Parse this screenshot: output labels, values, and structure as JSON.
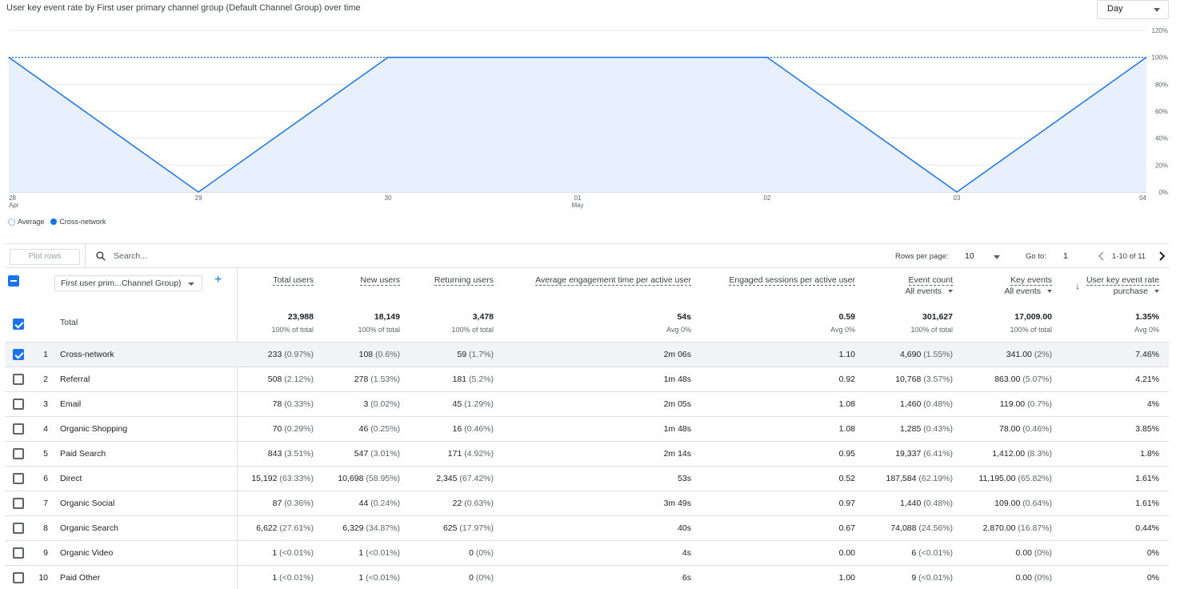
{
  "chart": {
    "title": "User key event rate by First user primary channel group (Default Channel Group) over time",
    "granularity": "Day",
    "legend": [
      {
        "label": "Average",
        "style": "dotted"
      },
      {
        "label": "Cross-network",
        "style": "solid"
      }
    ],
    "accent_color": "#1a73e8",
    "fill_color": "#e8f0fe"
  },
  "chart_data": {
    "type": "area",
    "title": "User key event rate by First user primary channel group (Default Channel Group) over time",
    "x_ticks": [
      {
        "label": "28",
        "sublabel": "Apr"
      },
      {
        "label": "29",
        "sublabel": ""
      },
      {
        "label": "30",
        "sublabel": ""
      },
      {
        "label": "01",
        "sublabel": "May"
      },
      {
        "label": "02",
        "sublabel": ""
      },
      {
        "label": "03",
        "sublabel": ""
      },
      {
        "label": "04",
        "sublabel": ""
      }
    ],
    "y_ticks": [
      "0%",
      "20%",
      "40%",
      "60%",
      "80%",
      "100%",
      "120%"
    ],
    "ylim": [
      0,
      120
    ],
    "series": [
      {
        "name": "Cross-network",
        "values": [
          100,
          0,
          100,
          100,
          100,
          0,
          100
        ]
      },
      {
        "name": "Average",
        "values": [
          100,
          100,
          100,
          100,
          100,
          100,
          100
        ]
      }
    ],
    "grid": true
  },
  "toolbar": {
    "plot_rows": "Plot rows",
    "search_placeholder": "Search...",
    "rows_per_page_label": "Rows per page:",
    "rows_per_page": "10",
    "goto_label": "Go to:",
    "goto_value": "1",
    "pager_text": "1-10 of 11"
  },
  "table": {
    "dimension": "First user prim...Channel Group)",
    "columns": [
      {
        "label": "Total users",
        "sub": ""
      },
      {
        "label": "New users",
        "sub": ""
      },
      {
        "label": "Returning users",
        "sub": ""
      },
      {
        "label": "Average engagement time per active user",
        "sub": ""
      },
      {
        "label": "Engaged sessions per active user",
        "sub": ""
      },
      {
        "label": "Event count",
        "sub": "All events"
      },
      {
        "label": "Key events",
        "sub": "All events"
      },
      {
        "label": "User key event rate",
        "sub": "purchase"
      }
    ],
    "total": {
      "label": "Total",
      "values": [
        "23,988",
        "18,149",
        "3,478",
        "54s",
        "0.59",
        "301,627",
        "17,009.00",
        "1.35%"
      ],
      "subs": [
        "100% of total",
        "100% of total",
        "100% of total",
        "Avg 0%",
        "Avg 0%",
        "100% of total",
        "100% of total",
        "Avg 0%"
      ]
    },
    "rows": [
      {
        "idx": "1",
        "name": "Cross-network",
        "checked": true,
        "cells": [
          [
            "233",
            "(0.97%)"
          ],
          [
            "108",
            "(0.6%)"
          ],
          [
            "59",
            "(1.7%)"
          ],
          [
            "2m 06s",
            ""
          ],
          [
            "1.10",
            ""
          ],
          [
            "4,690",
            "(1.55%)"
          ],
          [
            "341.00",
            "(2%)"
          ],
          [
            "7.46%",
            ""
          ]
        ]
      },
      {
        "idx": "2",
        "name": "Referral",
        "checked": false,
        "cells": [
          [
            "508",
            "(2.12%)"
          ],
          [
            "278",
            "(1.53%)"
          ],
          [
            "181",
            "(5.2%)"
          ],
          [
            "1m 48s",
            ""
          ],
          [
            "0.92",
            ""
          ],
          [
            "10,768",
            "(3.57%)"
          ],
          [
            "863.00",
            "(5.07%)"
          ],
          [
            "4.21%",
            ""
          ]
        ]
      },
      {
        "idx": "3",
        "name": "Email",
        "checked": false,
        "cells": [
          [
            "78",
            "(0.33%)"
          ],
          [
            "3",
            "(0.02%)"
          ],
          [
            "45",
            "(1.29%)"
          ],
          [
            "2m 05s",
            ""
          ],
          [
            "1.08",
            ""
          ],
          [
            "1,460",
            "(0.48%)"
          ],
          [
            "119.00",
            "(0.7%)"
          ],
          [
            "4%",
            ""
          ]
        ]
      },
      {
        "idx": "4",
        "name": "Organic Shopping",
        "checked": false,
        "cells": [
          [
            "70",
            "(0.29%)"
          ],
          [
            "46",
            "(0.25%)"
          ],
          [
            "16",
            "(0.46%)"
          ],
          [
            "1m 48s",
            ""
          ],
          [
            "1.08",
            ""
          ],
          [
            "1,285",
            "(0.43%)"
          ],
          [
            "78.00",
            "(0.46%)"
          ],
          [
            "3.85%",
            ""
          ]
        ]
      },
      {
        "idx": "5",
        "name": "Paid Search",
        "checked": false,
        "cells": [
          [
            "843",
            "(3.51%)"
          ],
          [
            "547",
            "(3.01%)"
          ],
          [
            "171",
            "(4.92%)"
          ],
          [
            "2m 14s",
            ""
          ],
          [
            "0.95",
            ""
          ],
          [
            "19,337",
            "(6.41%)"
          ],
          [
            "1,412.00",
            "(8.3%)"
          ],
          [
            "1.8%",
            ""
          ]
        ]
      },
      {
        "idx": "6",
        "name": "Direct",
        "checked": false,
        "cells": [
          [
            "15,192",
            "(63.33%)"
          ],
          [
            "10,698",
            "(58.95%)"
          ],
          [
            "2,345",
            "(67.42%)"
          ],
          [
            "53s",
            ""
          ],
          [
            "0.52",
            ""
          ],
          [
            "187,584",
            "(62.19%)"
          ],
          [
            "11,195.00",
            "(65.82%)"
          ],
          [
            "1.61%",
            ""
          ]
        ]
      },
      {
        "idx": "7",
        "name": "Organic Social",
        "checked": false,
        "cells": [
          [
            "87",
            "(0.36%)"
          ],
          [
            "44",
            "(0.24%)"
          ],
          [
            "22",
            "(0.63%)"
          ],
          [
            "3m 49s",
            ""
          ],
          [
            "0.97",
            ""
          ],
          [
            "1,440",
            "(0.48%)"
          ],
          [
            "109.00",
            "(0.64%)"
          ],
          [
            "1.61%",
            ""
          ]
        ]
      },
      {
        "idx": "8",
        "name": "Organic Search",
        "checked": false,
        "cells": [
          [
            "6,622",
            "(27.61%)"
          ],
          [
            "6,329",
            "(34.87%)"
          ],
          [
            "625",
            "(17.97%)"
          ],
          [
            "40s",
            ""
          ],
          [
            "0.67",
            ""
          ],
          [
            "74,088",
            "(24.56%)"
          ],
          [
            "2,870.00",
            "(16.87%)"
          ],
          [
            "0.44%",
            ""
          ]
        ]
      },
      {
        "idx": "9",
        "name": "Organic Video",
        "checked": false,
        "cells": [
          [
            "1",
            "(<0.01%)"
          ],
          [
            "1",
            "(<0.01%)"
          ],
          [
            "0",
            "(0%)"
          ],
          [
            "4s",
            ""
          ],
          [
            "0.00",
            ""
          ],
          [
            "6",
            "(<0.01%)"
          ],
          [
            "0.00",
            "(0%)"
          ],
          [
            "0%",
            ""
          ]
        ]
      },
      {
        "idx": "10",
        "name": "Paid Other",
        "checked": false,
        "cells": [
          [
            "1",
            "(<0.01%)"
          ],
          [
            "1",
            "(<0.01%)"
          ],
          [
            "0",
            "(0%)"
          ],
          [
            "6s",
            ""
          ],
          [
            "1.00",
            ""
          ],
          [
            "9",
            "(<0.01%)"
          ],
          [
            "0.00",
            "(0%)"
          ],
          [
            "0%",
            ""
          ]
        ]
      }
    ]
  }
}
